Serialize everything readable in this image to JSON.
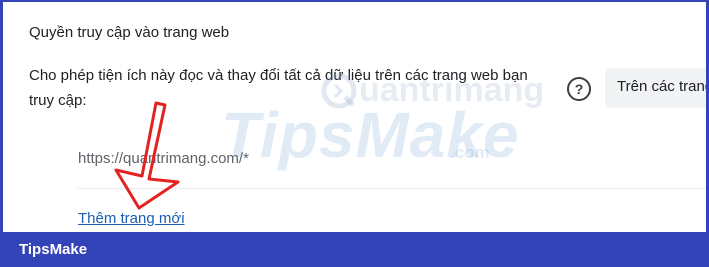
{
  "permissions": {
    "section_title": "Quyền truy cập vào trang web",
    "description": "Cho phép tiện ích này đọc và thay đổi tất cả dữ liệu trên các trang web bạn truy cập:",
    "help_icon": "help-circle-icon",
    "site_access_select": "Trên các trang",
    "site_url": "https://quantrimang.com/*",
    "add_site_link": "Thêm trang mới"
  },
  "watermarks": {
    "main_text": "TipsMake",
    "main_suffix": ".com",
    "brand_text": "uantrimang",
    "brand_icon": "quantrimang-logo-icon"
  },
  "annotation": {
    "icon": "red-arrow-down-icon"
  },
  "footer": {
    "brand_label": "TipsMake"
  },
  "colors": {
    "banner_background": "#3344b8",
    "link": "#1a5fb4",
    "arrow": "#e32222",
    "dropdown_background": "#f1f3f4"
  }
}
